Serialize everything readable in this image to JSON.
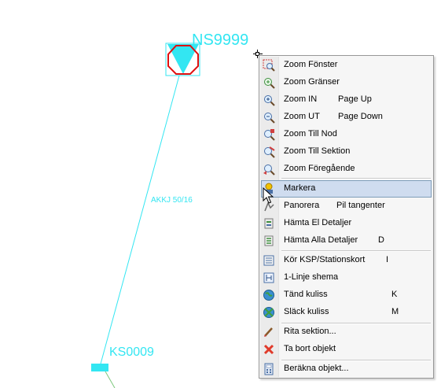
{
  "map": {
    "node_top_label": "NS9999",
    "node_bottom_label": "KS0009",
    "cable_label": "AKKJ 50/16",
    "line_color": "#33e6f2",
    "marker_color": "#e01010"
  },
  "context_menu": {
    "highlight_color": "#cfdcef",
    "items": [
      {
        "label": "Zoom Fönster",
        "shortcut": "",
        "icon": "zoom-window-icon"
      },
      {
        "label": "Zoom Gränser",
        "shortcut": "",
        "icon": "zoom-extents-icon"
      },
      {
        "label": "Zoom IN",
        "shortcut": "Page Up",
        "icon": "zoom-in-icon"
      },
      {
        "label": "Zoom UT",
        "shortcut": "Page Down",
        "icon": "zoom-out-icon"
      },
      {
        "label": "Zoom Till Nod",
        "shortcut": "",
        "icon": "zoom-to-node-icon"
      },
      {
        "label": "Zoom Till Sektion",
        "shortcut": "",
        "icon": "zoom-to-section-icon"
      },
      {
        "label": "Zoom Föregående",
        "shortcut": "",
        "icon": "zoom-previous-icon"
      },
      {
        "label": "Markera",
        "shortcut": "",
        "icon": "select-icon",
        "highlighted": true
      },
      {
        "label": "Panorera",
        "shortcut": "Pil tangenter",
        "icon": "pan-icon"
      },
      {
        "label": "Hämta El Detaljer",
        "shortcut": "",
        "icon": "fetch-details-icon"
      },
      {
        "label": "Hämta Alla Detaljer",
        "shortcut": "D",
        "icon": "fetch-all-details-icon"
      },
      {
        "label": "Kör KSP/Stationskort",
        "shortcut": "I",
        "icon": "station-card-icon"
      },
      {
        "label": "1-Linje shema",
        "shortcut": "",
        "icon": "single-line-diagram-icon"
      },
      {
        "label": "Tänd kuliss",
        "shortcut": "K",
        "icon": "backdrop-on-icon"
      },
      {
        "label": "Släck kuliss",
        "shortcut": "M",
        "icon": "backdrop-off-icon"
      },
      {
        "label": "Rita sektion...",
        "shortcut": "",
        "icon": "draw-section-icon"
      },
      {
        "label": "Ta bort objekt",
        "shortcut": "",
        "icon": "delete-object-icon"
      },
      {
        "label": "Beräkna objekt...",
        "shortcut": "",
        "icon": "calculate-object-icon"
      }
    ]
  }
}
